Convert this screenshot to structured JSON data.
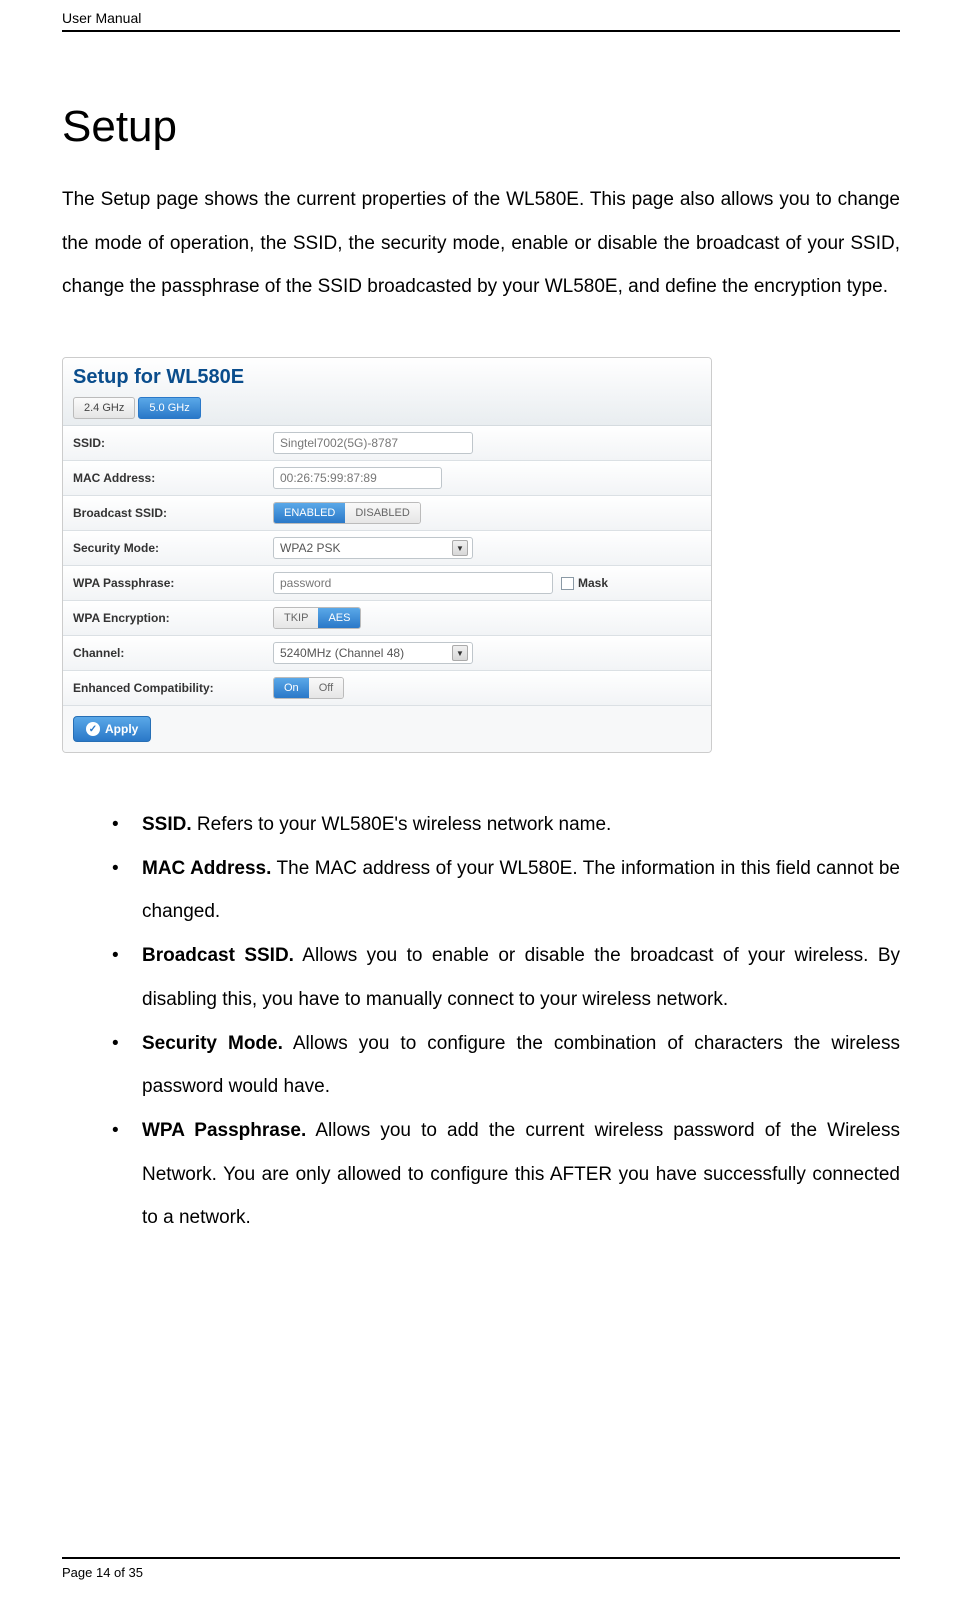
{
  "header": {
    "doc_title": "User Manual"
  },
  "page": {
    "title": "Setup",
    "intro": "The Setup page shows the current properties of the WL580E. This page also allows you to change the mode of operation, the SSID, the security mode, enable or disable the broadcast of your SSID, change the passphrase of the SSID broadcasted by your WL580E, and define the encryption type."
  },
  "screenshot": {
    "title": "Setup for WL580E",
    "tabs": {
      "a": "2.4 GHz",
      "b": "5.0 GHz"
    },
    "labels": {
      "ssid": "SSID:",
      "mac": "MAC Address:",
      "broadcast": "Broadcast SSID:",
      "secmode": "Security Mode:",
      "passphrase": "WPA Passphrase:",
      "encryption": "WPA Encryption:",
      "channel": "Channel:",
      "compat": "Enhanced Compatibility:"
    },
    "values": {
      "ssid": "Singtel7002(5G)-8787",
      "mac": "00:26:75:99:87:89",
      "enabled": "ENABLED",
      "disabled": "DISABLED",
      "secmode": "WPA2 PSK",
      "passphrase": "password",
      "mask_label": "Mask",
      "tkip": "TKIP",
      "aes": "AES",
      "channel": "5240MHz (Channel 48)",
      "on": "On",
      "off": "Off"
    },
    "apply_label": "Apply"
  },
  "bullets": {
    "b1_term": "SSID.",
    "b1_text": " Refers to your WL580E's wireless network name.",
    "b2_term": "MAC Address.",
    "b2_text": " The MAC address of your WL580E. The information in this field cannot be changed.",
    "b3_term": "Broadcast SSID.",
    "b3_text": " Allows you to enable or disable the broadcast of your wireless. By disabling this, you have to manually connect to your wireless network.",
    "b4_term": "Security Mode.",
    "b4_text": " Allows you to configure the combination of characters the wireless password would have.",
    "b5_term": "WPA Passphrase.",
    "b5_text": " Allows you to add the current wireless password of the Wireless Network. You are only allowed to configure this AFTER you have successfully connected to a network."
  },
  "footer": {
    "page": "Page 14 of 35"
  }
}
